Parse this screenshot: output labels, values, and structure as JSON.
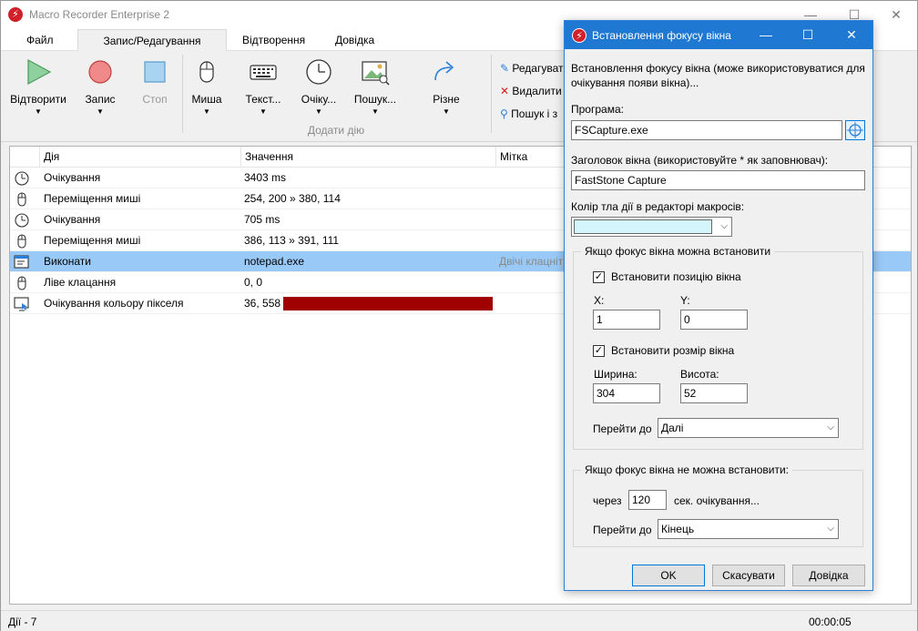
{
  "app": {
    "title": "Macro Recorder Enterprise 2"
  },
  "menu": {
    "tabs": [
      "Файл",
      "Запис/Редагування",
      "Відтворення",
      "Довідка"
    ],
    "active_index": 1
  },
  "ribbon": {
    "play_label": "Відтворити",
    "record_label": "Запис",
    "stop_label": "Стоп",
    "mouse_label": "Миша",
    "text_label": "Текст...",
    "wait_label": "Очіку...",
    "search_label": "Пошук...",
    "misc_label": "Різне",
    "group_label": "Додати дію",
    "edit_label": "Редагувати",
    "delete_label": "Видалити",
    "find_label": "Пошук і з"
  },
  "table": {
    "headers": [
      "Дія",
      "Значення",
      "Мітка"
    ],
    "rows": [
      {
        "icon": "clock-icon",
        "action": "Очікування",
        "value": "3403 ms",
        "label": ""
      },
      {
        "icon": "mouse-icon",
        "action": "Переміщення миші",
        "value": "254, 200 » 380, 114",
        "label": ""
      },
      {
        "icon": "clock-icon",
        "action": "Очікування",
        "value": "705 ms",
        "label": ""
      },
      {
        "icon": "mouse-icon",
        "action": "Переміщення миші",
        "value": "386, 113 » 391, 111",
        "label": ""
      },
      {
        "icon": "window-run-icon",
        "action": "Виконати",
        "value": "notepad.exe",
        "label": "Двічі клацніт"
      },
      {
        "icon": "mouse-icon",
        "action": "Ліве клацання",
        "value": "0, 0",
        "label": ""
      },
      {
        "icon": "monitor-pixel-icon",
        "action": "Очікування кольору пікселя",
        "value": "36, 558",
        "label": "",
        "color": "#a00000"
      }
    ],
    "selected_index": 4
  },
  "status": {
    "left": "Дії - 7",
    "right": "00:00:05"
  },
  "dialog": {
    "title": "Встановлення фокусу вікна",
    "description": "Встановлення фокусу вікна (може використовуватися для очікування появи вікна)...",
    "program_label": "Програма:",
    "program_value": "FSCapture.exe",
    "window_title_label": "Заголовок вікна (використовуйте * як заповнювач):",
    "window_title_value": "FastStone Capture",
    "bg_color_label": "Колір тла дії в редакторі макросів:",
    "bg_color_value": "#d4f5fb",
    "group_success": {
      "title": "Якщо фокус вікна можна встановити",
      "set_position_label": "Встановити позицію вікна",
      "x_label": "X:",
      "x_value": "1",
      "y_label": "Y:",
      "y_value": "0",
      "set_size_label": "Встановити розмір вікна",
      "width_label": "Ширина:",
      "width_value": "304",
      "height_label": "Висота:",
      "height_value": "52",
      "goto_label": "Перейти до",
      "goto_value": "Далі"
    },
    "group_fail": {
      "title": "Якщо фокус вікна не можна встановити:",
      "after_label": "через",
      "after_value": "120",
      "seconds_label": "сек. очікування...",
      "goto_label": "Перейти до",
      "goto_value": "Кінець"
    },
    "ok_label": "OK",
    "cancel_label": "Скасувати",
    "help_label": "Довідка"
  }
}
